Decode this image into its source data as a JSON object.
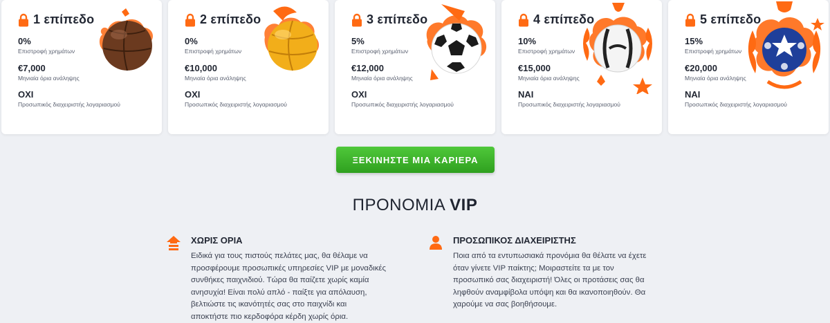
{
  "levels": [
    {
      "title": "1 επίπεδο",
      "cashback": "0%",
      "cashback_label": "Επιστροφή χρημάτων",
      "limit": "€7,000",
      "limit_label": "Μηνιαία όρια ανάληψης",
      "manager": "ΟΧΙ",
      "manager_label": "Προσωπικός διαχειριστής λογαριασμού",
      "ball": "vintage-brown-ball-icon"
    },
    {
      "title": "2 επίπεδο",
      "cashback": "0%",
      "cashback_label": "Επιστροφή χρημάτων",
      "limit": "€10,000",
      "limit_label": "Μηνιαία όρια ανάληψης",
      "manager": "ΟΧΙ",
      "manager_label": "Προσωπικός διαχειριστής λογαριασμού",
      "ball": "vintage-yellow-ball-icon"
    },
    {
      "title": "3 επίπεδο",
      "cashback": "5%",
      "cashback_label": "Επιστροφή χρημάτων",
      "limit": "€12,000",
      "limit_label": "Μηνιαία όρια ανάληψης",
      "manager": "ΟΧΙ",
      "manager_label": "Προσωπικός διαχειριστής λογαριασμού",
      "ball": "classic-soccer-ball-icon"
    },
    {
      "title": "4 επίπεδο",
      "cashback": "10%",
      "cashback_label": "Επιστροφή χρημάτων",
      "limit": "€15,000",
      "limit_label": "Μηνιαία όρια ανάληψης",
      "manager": "ΝΑΙ",
      "manager_label": "Προσωπικός διαχειριστής λογαριασμού",
      "ball": "modern-white-ball-icon"
    },
    {
      "title": "5 επίπεδο",
      "cashback": "15%",
      "cashback_label": "Επιστροφή χρημάτων",
      "limit": "€20,000",
      "limit_label": "Μηνιαία όρια ανάληψης",
      "manager": "ΝΑΙ",
      "manager_label": "Προσωπικός διαχειριστής λογαριασμού",
      "ball": "star-blue-ball-icon"
    }
  ],
  "cta": {
    "label": "ΞΕΚΙΝΗΣΤΕ ΜΙΑ ΚΑΡΙΕΡΑ"
  },
  "section": {
    "title_prefix": "ΠΡΟΝΟΜΙΑ ",
    "title_bold": "VIP"
  },
  "features": [
    {
      "icon": "house-arrow-icon",
      "title": "ΧΩΡΙΣ ΟΡΙΑ",
      "lines": [
        "Ειδικά για τους πιστούς πελάτες μας, θα θέλαμε να",
        "προσφέρουμε προσωπικές υπηρεσίες VIP με μοναδικές",
        "συνθήκες παιχνιδιού. Τώρα θα παίζετε χωρίς καμία",
        "ανησυχία! Είναι πολύ απλό - παίξτε για απόλαυση,",
        "βελτιώστε τις ικανότητές σας στο παιχνίδι και",
        "αποκτήστε πιο κερδοφόρα κέρδη χωρίς όρια."
      ]
    },
    {
      "icon": "person-icon",
      "title": "ΠΡΟΣΩΠΙΚΟΣ ΔΙΑΧΕΙΡΙΣΤΗΣ",
      "lines": [
        "Ποια από τα εντυπωσιακά προνόμια θα θέλατε να έχετε",
        "όταν γίνετε VIP παίκτης; Μοιραστείτε τα με τον",
        "προσωπικό σας διαχειριστή! Όλες οι προτάσεις σας θα",
        "ληφθούν αναμφίβολα υπόψη και θα ικανοποιηθούν. Θα",
        "χαρούμε να σας βοηθήσουμε."
      ]
    }
  ],
  "colors": {
    "accent": "#ff6a13",
    "cta": "#3bb22a",
    "background": "#eef0f4"
  }
}
